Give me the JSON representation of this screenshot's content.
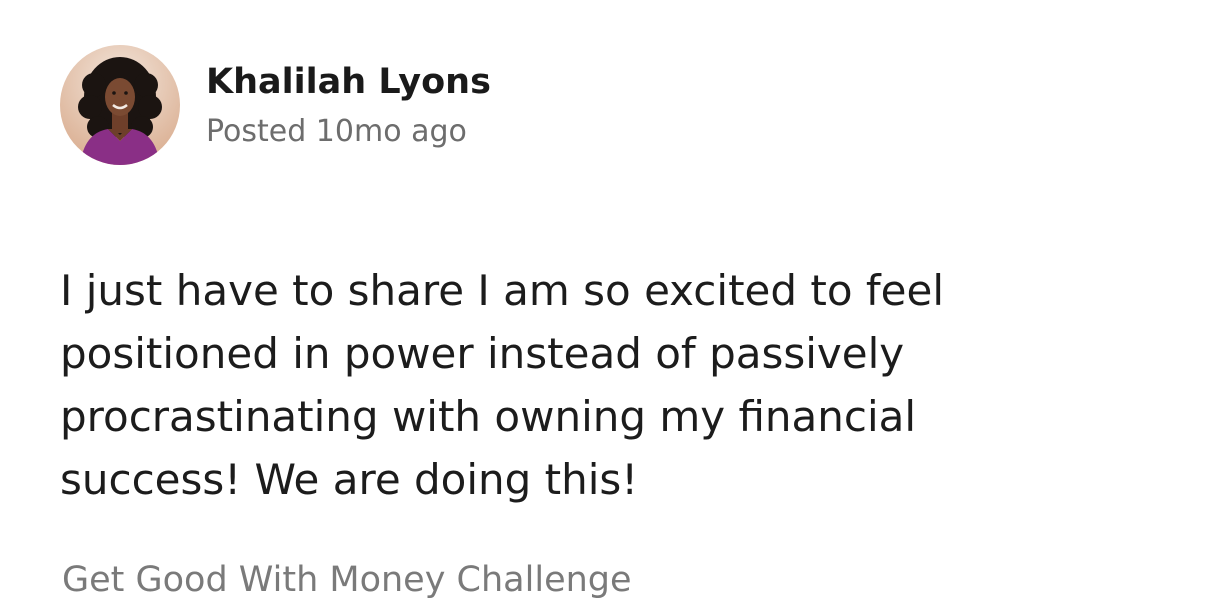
{
  "post": {
    "author": {
      "name": "Khalilah Lyons",
      "avatar_icon": "profile-photo"
    },
    "meta": "Posted 10mo ago",
    "body_lines": [
      "I just have to share I am so excited to feel",
      "positioned in power instead of passively",
      "procrastinating with owning my financial",
      "success! We are doing this!"
    ],
    "group": "Get Good With Money Challenge"
  },
  "colors": {
    "background": "#ffffff",
    "name_text": "#1a1a1a",
    "meta_text": "#6d6d6d",
    "body_text": "#1c1c1c",
    "group_text": "#7a7a7a",
    "avatar_bg": "#e0b9a0",
    "avatar_top": "#f1e3d8",
    "hair": "#1b1411",
    "skin": "#7a4a32",
    "blouse": "#8a2f86"
  }
}
